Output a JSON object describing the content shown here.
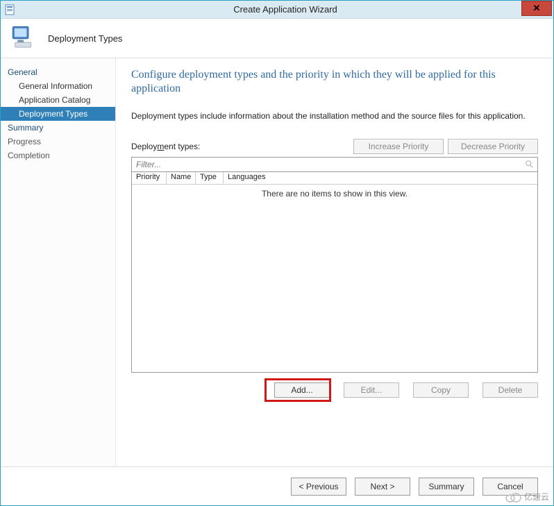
{
  "titlebar": {
    "title": "Create Application Wizard"
  },
  "header": {
    "step": "Deployment Types"
  },
  "sidebar": {
    "general": "General",
    "general_info": "General Information",
    "app_catalog": "Application Catalog",
    "deployment_types": "Deployment Types",
    "summary": "Summary",
    "progress": "Progress",
    "completion": "Completion"
  },
  "main": {
    "heading": "Configure deployment types and the priority in which they will be applied for this application",
    "description": "Deployment types include information about the installation method and the source files for this application.",
    "dt_label_pre": "Deploy",
    "dt_label_u": "m",
    "dt_label_post": "ent types:",
    "increase": "Increase Priority",
    "decrease": "Decrease Priority",
    "filter_placeholder": "Filter...",
    "columns": {
      "c1": "Priority",
      "c2": "Name",
      "c3": "Type",
      "c4": "Languages"
    },
    "empty": "There are no items to show in this view.",
    "add": "Add...",
    "edit": "Edit...",
    "copy": "Copy",
    "delete": "Delete"
  },
  "footer": {
    "previous": "< Previous",
    "next": "Next >",
    "summary": "Summary",
    "cancel": "Cancel"
  },
  "watermark": {
    "text": "亿速云"
  }
}
